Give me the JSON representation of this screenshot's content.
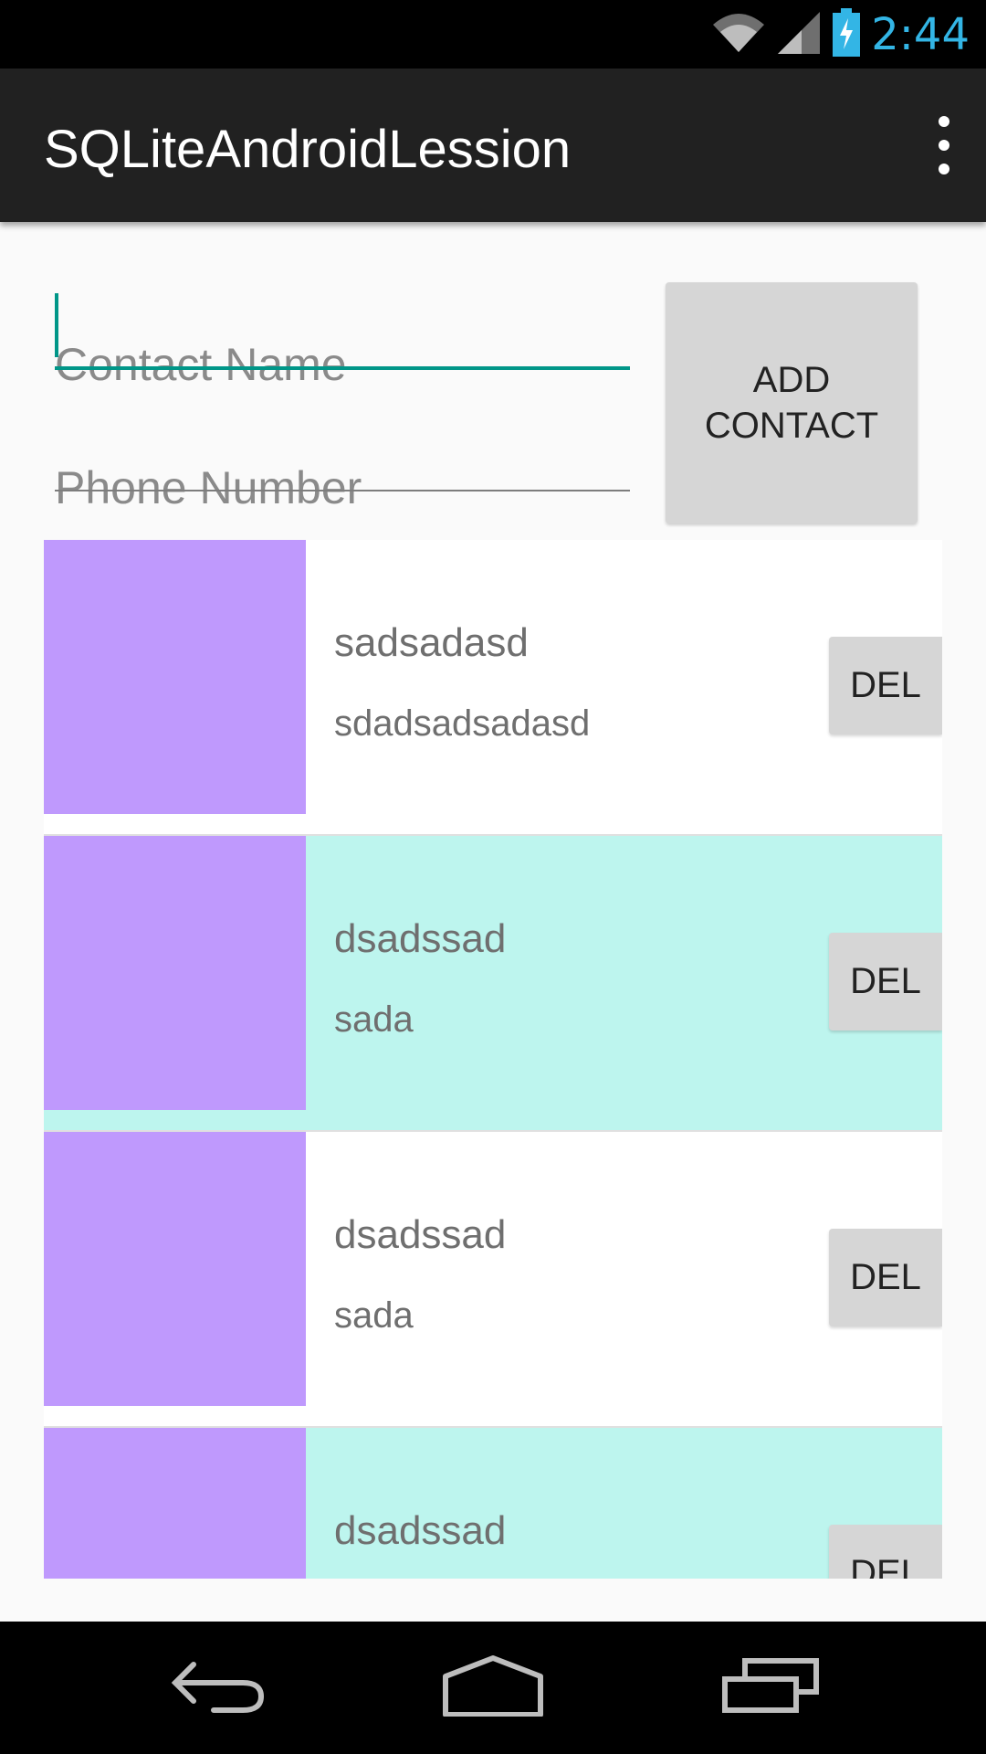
{
  "status_bar": {
    "time": "2:44",
    "icons": [
      "wifi-icon",
      "signal-icon",
      "battery-charging-icon"
    ]
  },
  "app_bar": {
    "title": "SQLiteAndroidLession",
    "menu_icon": "overflow-menu-icon"
  },
  "form": {
    "name_placeholder": "Contact Name",
    "name_value": "",
    "phone_placeholder": "Phone Number",
    "phone_value": "",
    "add_button_line1": "ADD",
    "add_button_line2": "CONTACT",
    "accent_color": "#009688"
  },
  "contacts": [
    {
      "name": "sadsadasd",
      "phone": "sdadsadsadasd",
      "delete_label": "DEL"
    },
    {
      "name": "dsadssad",
      "phone": "sada",
      "delete_label": "DEL"
    },
    {
      "name": "dsadssad",
      "phone": "sada",
      "delete_label": "DEL"
    },
    {
      "name": "dsadssad",
      "phone": "",
      "delete_label": "DEL"
    }
  ],
  "colors": {
    "avatar": "#bf99fd",
    "row_alt": "#bdf5ee",
    "time": "#33b5e5"
  },
  "navigation": {
    "back_icon": "back-icon",
    "home_icon": "home-icon",
    "recents_icon": "recents-icon"
  }
}
